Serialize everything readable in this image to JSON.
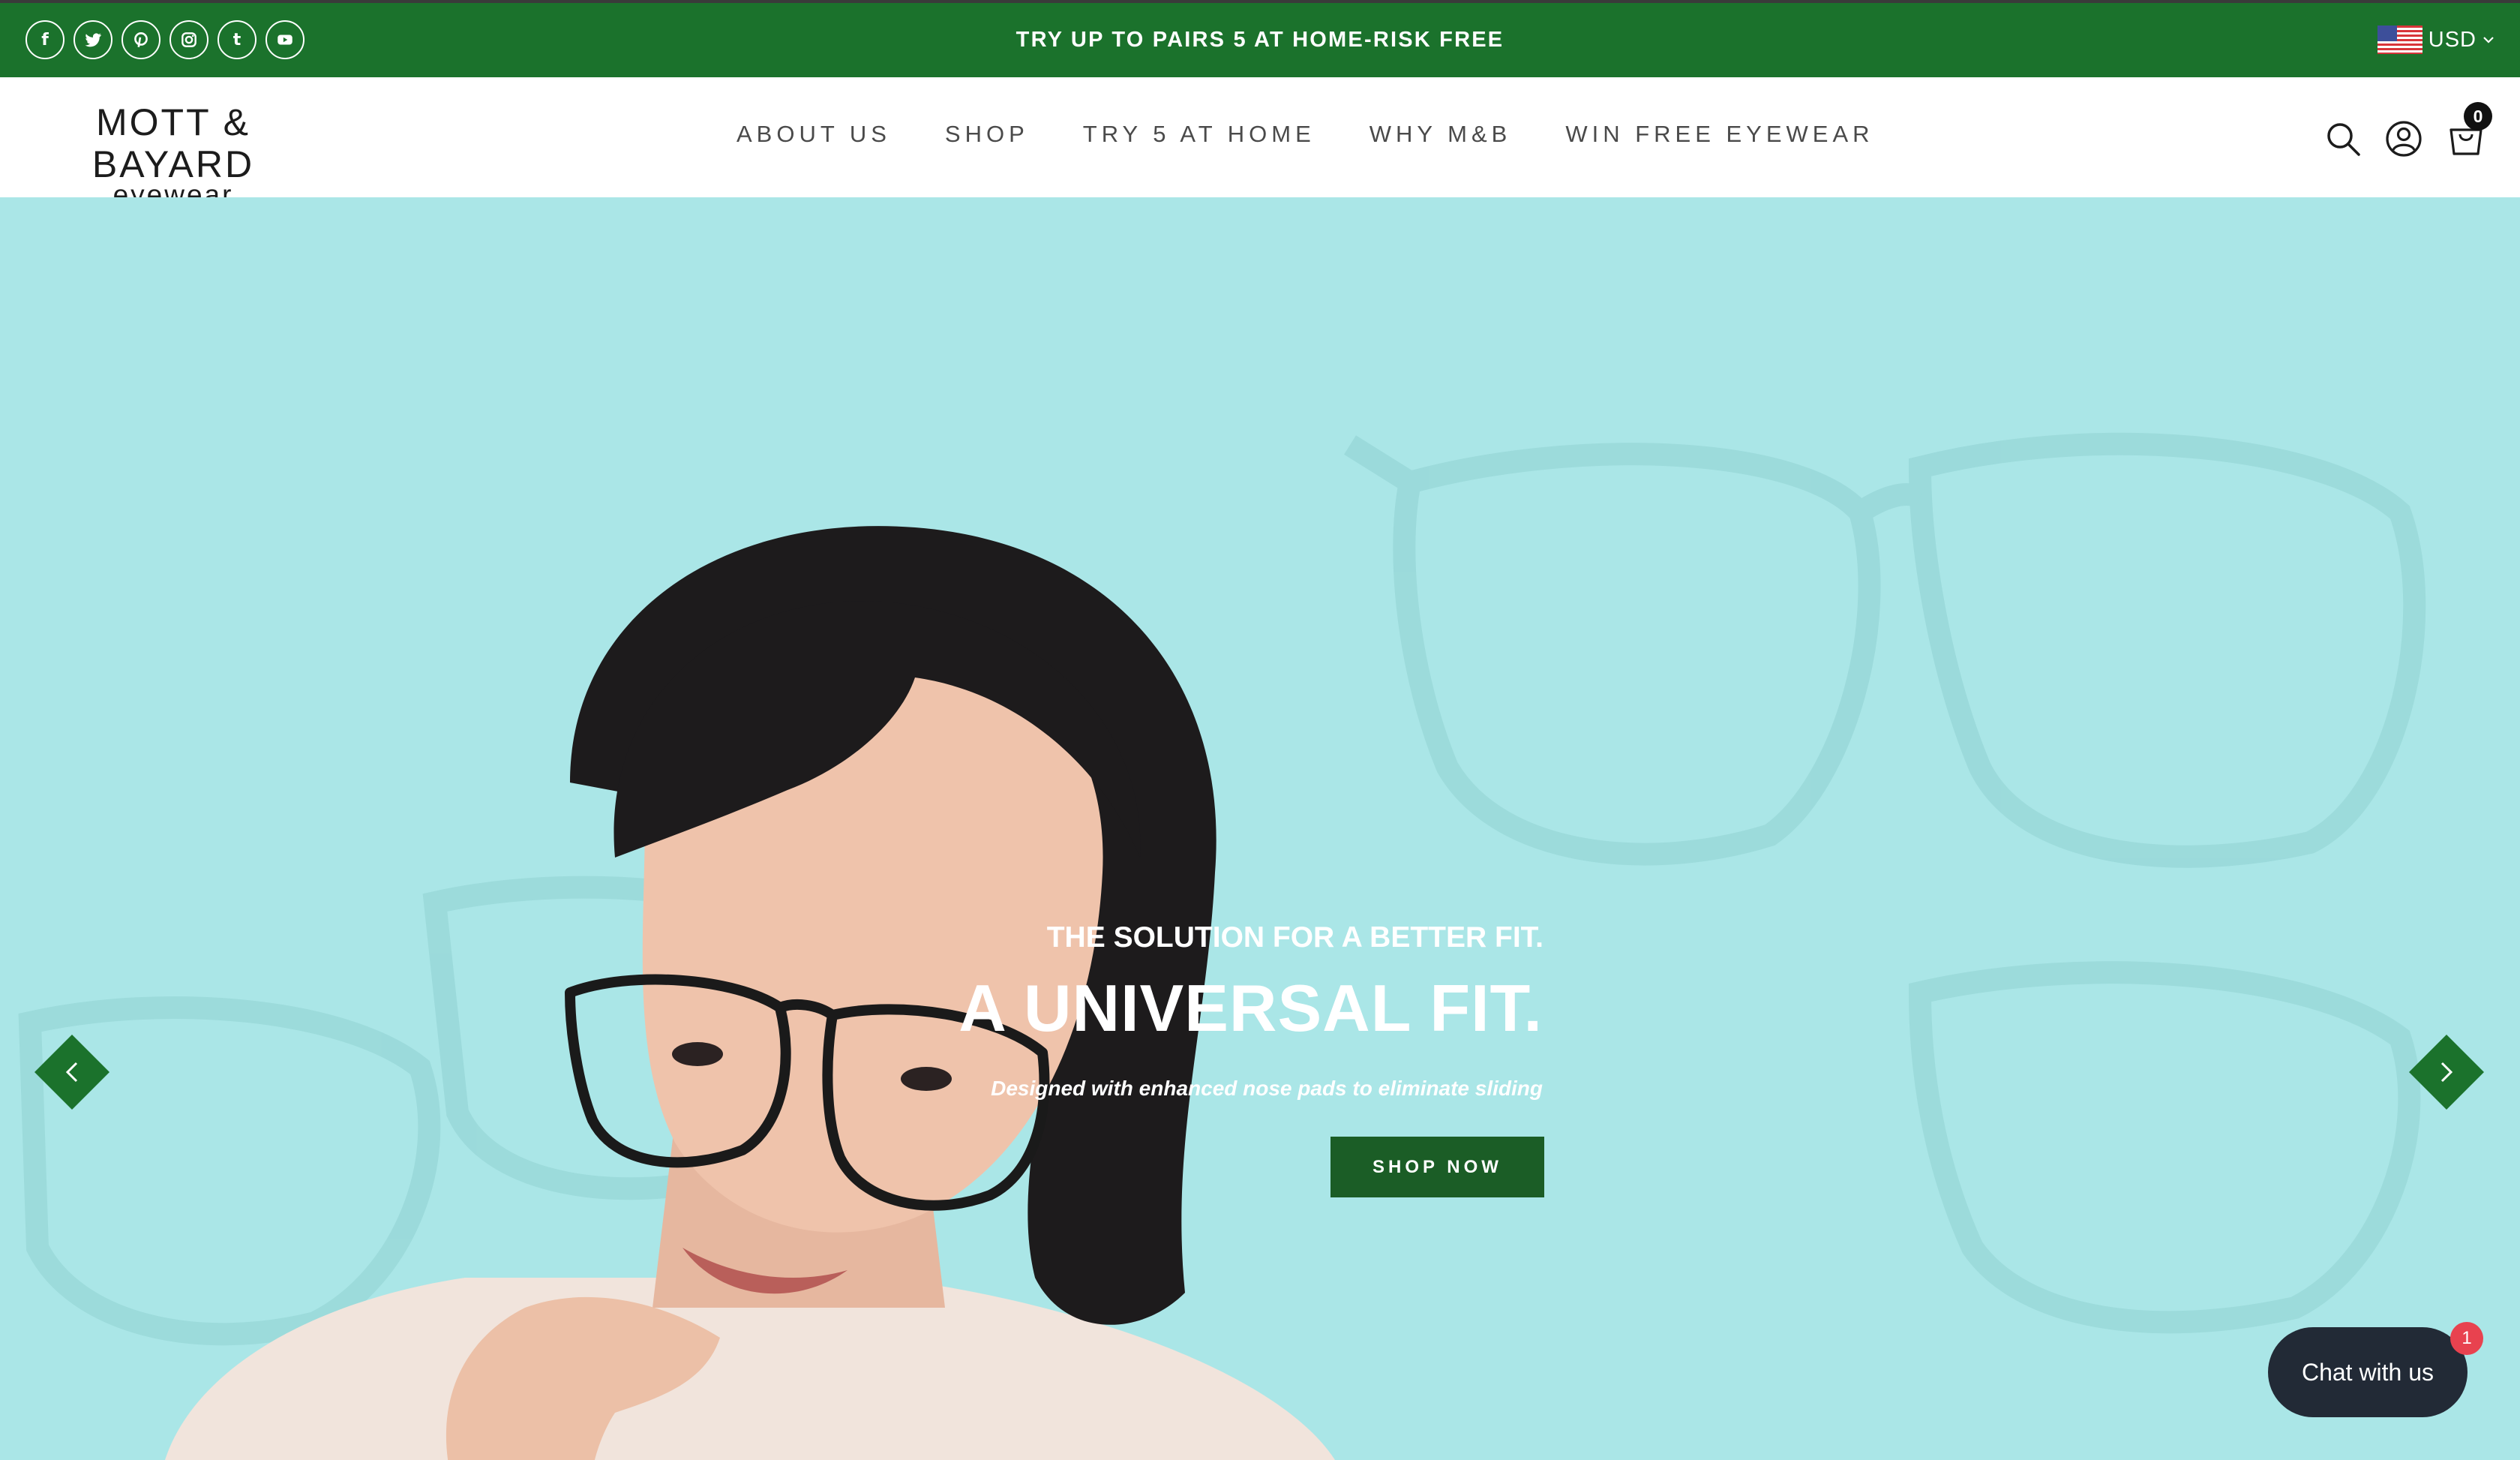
{
  "topbar": {
    "promo": "TRY UP TO PAIRS 5 AT HOME-RISK FREE",
    "currency": "USD",
    "social": [
      {
        "name": "facebook-icon",
        "glyph": "f"
      },
      {
        "name": "twitter-icon",
        "glyph": ""
      },
      {
        "name": "pinterest-icon",
        "glyph": ""
      },
      {
        "name": "instagram-icon",
        "glyph": ""
      },
      {
        "name": "tumblr-icon",
        "glyph": "t"
      },
      {
        "name": "youtube-icon",
        "glyph": ""
      }
    ]
  },
  "header": {
    "logo_main": "MOTT & BAYARD",
    "logo_sub": "eyewear",
    "nav": [
      "ABOUT US",
      "SHOP",
      "TRY 5 AT HOME",
      "WHY M&B",
      "WIN FREE EYEWEAR"
    ],
    "cart_count": "0"
  },
  "hero": {
    "kicker": "THE SOLUTION FOR A BETTER FIT.",
    "headline": "A UNIVERSAL FIT.",
    "subline": "Designed with enhanced nose pads to eliminate sliding",
    "cta": "SHOP NOW"
  },
  "chat": {
    "label": "Chat with us",
    "badge": "1"
  },
  "colors": {
    "brand_green": "#1b722c",
    "cta_green": "#1b5d26",
    "hero_bg": "#aae6e7",
    "chat_bg": "#222a36",
    "badge_red": "#e8424f"
  }
}
